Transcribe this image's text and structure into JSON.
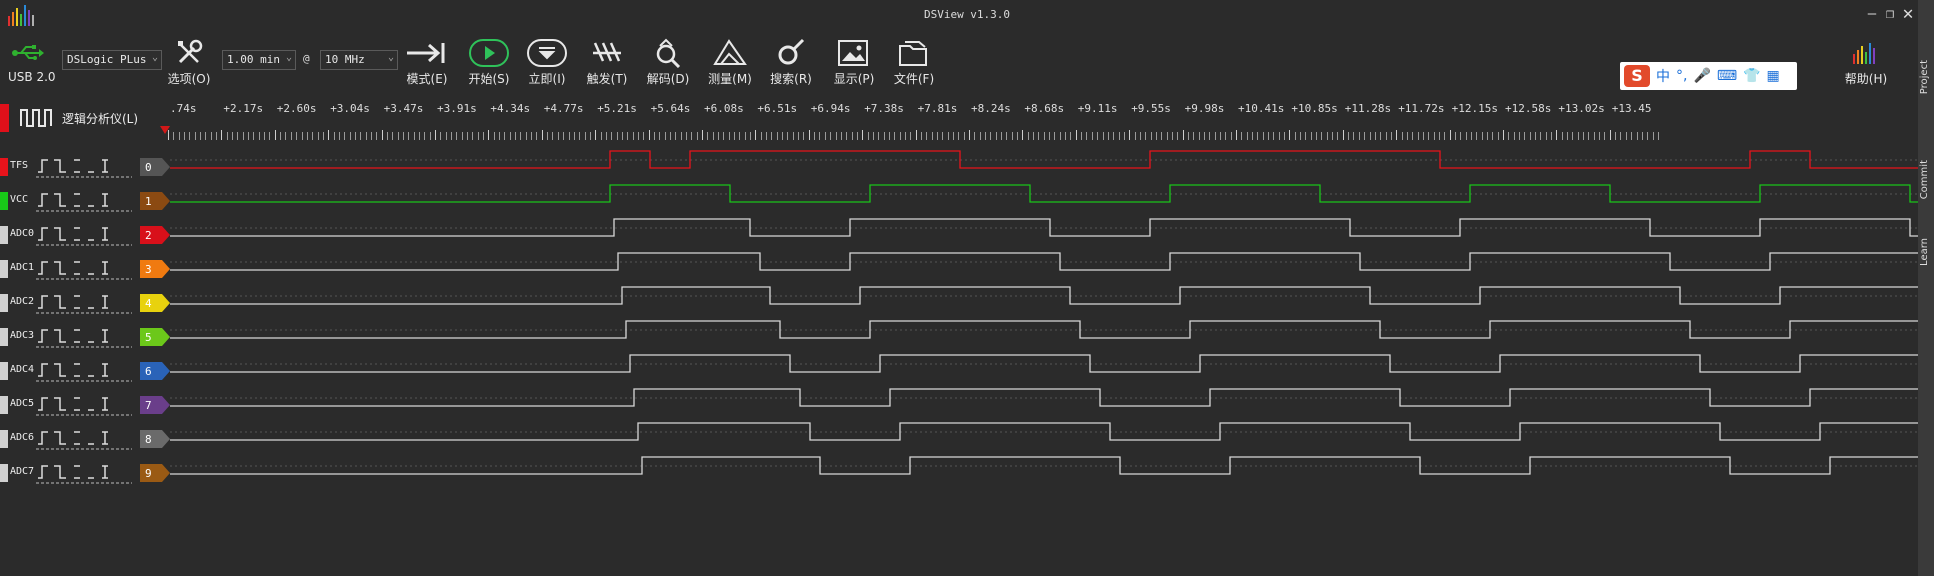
{
  "window": {
    "title": "DSView v1.3.0",
    "minimize": "—",
    "restore": "❐",
    "close": "✕"
  },
  "toolbar": {
    "usb_label": "USB 2.0",
    "device": "DSLogic PLus",
    "duration": "1.00 min",
    "at": "@",
    "samplerate": "10 MHz",
    "options": "选项(O)",
    "mode": "模式(E)",
    "start": "开始(S)",
    "instant": "立即(I)",
    "trigger": "触发(T)",
    "decode": "解码(D)",
    "measure": "测量(M)",
    "search": "搜索(R)",
    "display": "显示(P)",
    "file": "文件(F)",
    "help": "帮助(H)"
  },
  "ime": {
    "logo": "S",
    "chinese": "中"
  },
  "ruler": {
    "ticks": [
      ".74s",
      "+2.17s",
      "+2.60s",
      "+3.04s",
      "+3.47s",
      "+3.91s",
      "+4.34s",
      "+4.77s",
      "+5.21s",
      "+5.64s",
      "+6.08s",
      "+6.51s",
      "+6.94s",
      "+7.38s",
      "+7.81s",
      "+8.24s",
      "+8.68s",
      "+9.11s",
      "+9.55s",
      "+9.98s",
      "+10.41s",
      "+10.85s",
      "+11.28s",
      "+11.72s",
      "+12.15s",
      "+12.58s",
      "+13.02s",
      "+13.45"
    ]
  },
  "group": {
    "label": "逻辑分析仪(L)"
  },
  "channels": [
    {
      "name": "TFS",
      "num": "0",
      "color": "#e8131b",
      "tag": "#555555",
      "wave": "#e8131b"
    },
    {
      "name": "VCC",
      "num": "1",
      "color": "#18c818",
      "tag": "#8b4a12",
      "wave": "#19c419"
    },
    {
      "name": "ADC0",
      "num": "2",
      "color": "#d0d0d0",
      "tag": "#d8101a",
      "wave": "#d8d8d8"
    },
    {
      "name": "ADC1",
      "num": "3",
      "color": "#d0d0d0",
      "tag": "#f07a10",
      "wave": "#d8d8d8"
    },
    {
      "name": "ADC2",
      "num": "4",
      "color": "#d0d0d0",
      "tag": "#e8d20e",
      "wave": "#d8d8d8"
    },
    {
      "name": "ADC3",
      "num": "5",
      "color": "#d0d0d0",
      "tag": "#6cc81a",
      "wave": "#d8d8d8"
    },
    {
      "name": "ADC4",
      "num": "6",
      "color": "#d0d0d0",
      "tag": "#2a63b8",
      "wave": "#d8d8d8"
    },
    {
      "name": "ADC5",
      "num": "7",
      "color": "#d0d0d0",
      "tag": "#6a3e8a",
      "wave": "#d8d8d8"
    },
    {
      "name": "ADC6",
      "num": "8",
      "color": "#d0d0d0",
      "tag": "#6a6a6a",
      "wave": "#d8d8d8"
    },
    {
      "name": "ADC7",
      "num": "9",
      "color": "#d0d0d0",
      "tag": "#9a5a14",
      "wave": "#d8d8d8"
    }
  ],
  "side_tabs": [
    "Project",
    "Commit",
    "Learn"
  ]
}
